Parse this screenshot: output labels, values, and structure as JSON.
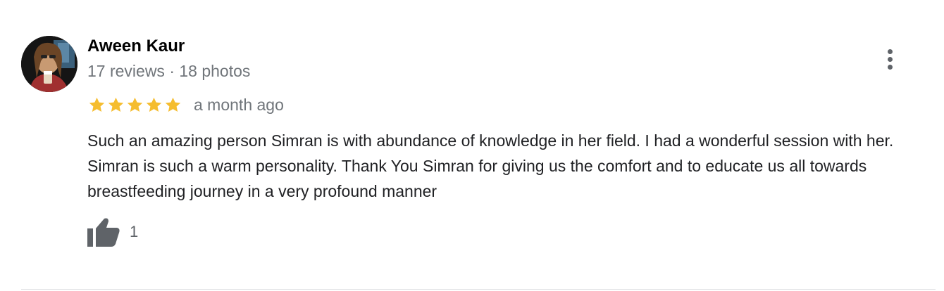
{
  "review": {
    "author_name": "Aween Kaur",
    "author_meta": "17 reviews · 18 photos",
    "rating": 5,
    "rating_max": 5,
    "date": "a month ago",
    "text": "Such an amazing person Simran is with abundance of knowledge in her field. I had a wonderful session with her. Simran is such a warm personality. Thank You Simran for giving us the comfort and to educate us all towards breastfeeding journey in a very profound manner",
    "like_count": "1",
    "icons": {
      "more": "more-vert-icon",
      "like": "thumb-up-icon",
      "star": "star-icon"
    }
  },
  "colors": {
    "star": "#f5bd2f",
    "meta_text": "#70757a",
    "icon": "#5f6368",
    "divider": "#dadce0"
  }
}
